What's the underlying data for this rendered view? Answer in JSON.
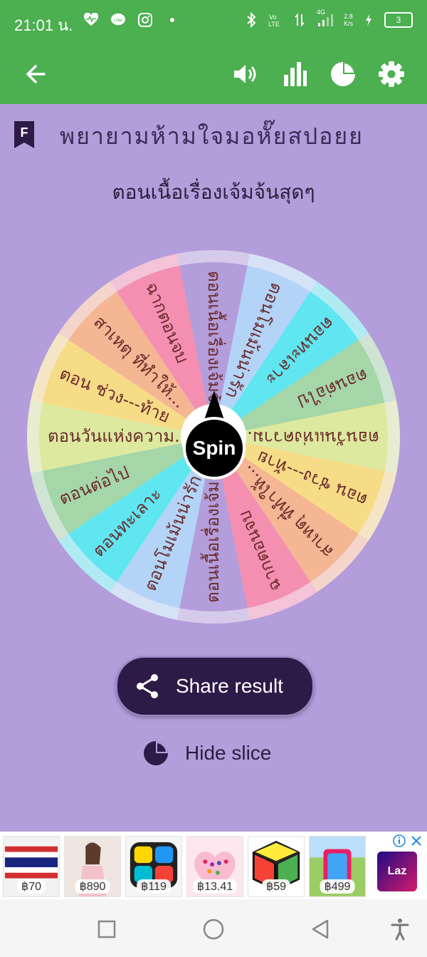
{
  "status_bar": {
    "time": "21:01 น.",
    "network": "4G",
    "speed_value": "2.8",
    "speed_unit": "K/s",
    "battery": "3"
  },
  "app_bar": {
    "icons": [
      "back-arrow-icon",
      "volume-icon",
      "stats-icon",
      "pie-icon",
      "settings-icon"
    ]
  },
  "title": {
    "badge": "F",
    "text": "พยายามห้ามใจมอหั๊ยสปอยย"
  },
  "result": "ตอนเนื้อเรื่องเจ้มจ้นสุดๆ",
  "wheel": {
    "slices": [
      {
        "label": "ตอนเนื้อเรื่องเจ้มจ้นสุดๆ",
        "color": "#b39ddb"
      },
      {
        "label": "ตอนโมเม้นน่ารัก",
        "color": "#b3d4f7"
      },
      {
        "label": "ตอนทะเลาะ",
        "color": "#60e6f0"
      },
      {
        "label": "ตอนต่อไป",
        "color": "#a5d6a7"
      },
      {
        "label": "ตอนวันแห่งความ...",
        "color": "#dce99f"
      },
      {
        "label": "ตอน ช่วง---ท้าย",
        "color": "#f7dc87"
      },
      {
        "label": "สาเหตุ ที่ทำให้...",
        "color": "#f5b694"
      },
      {
        "label": "ฉากตอนจบ",
        "color": "#f48fb1"
      }
    ],
    "spin_label": "Spin"
  },
  "actions": {
    "share_label": "Share result",
    "hide_label": "Hide slice"
  },
  "ads": {
    "items": [
      {
        "price": "฿70"
      },
      {
        "price": "฿890"
      },
      {
        "price": "฿119"
      },
      {
        "price": "฿13.41"
      },
      {
        "price": "฿59"
      },
      {
        "price": "฿499"
      }
    ],
    "brand": "Laz"
  }
}
